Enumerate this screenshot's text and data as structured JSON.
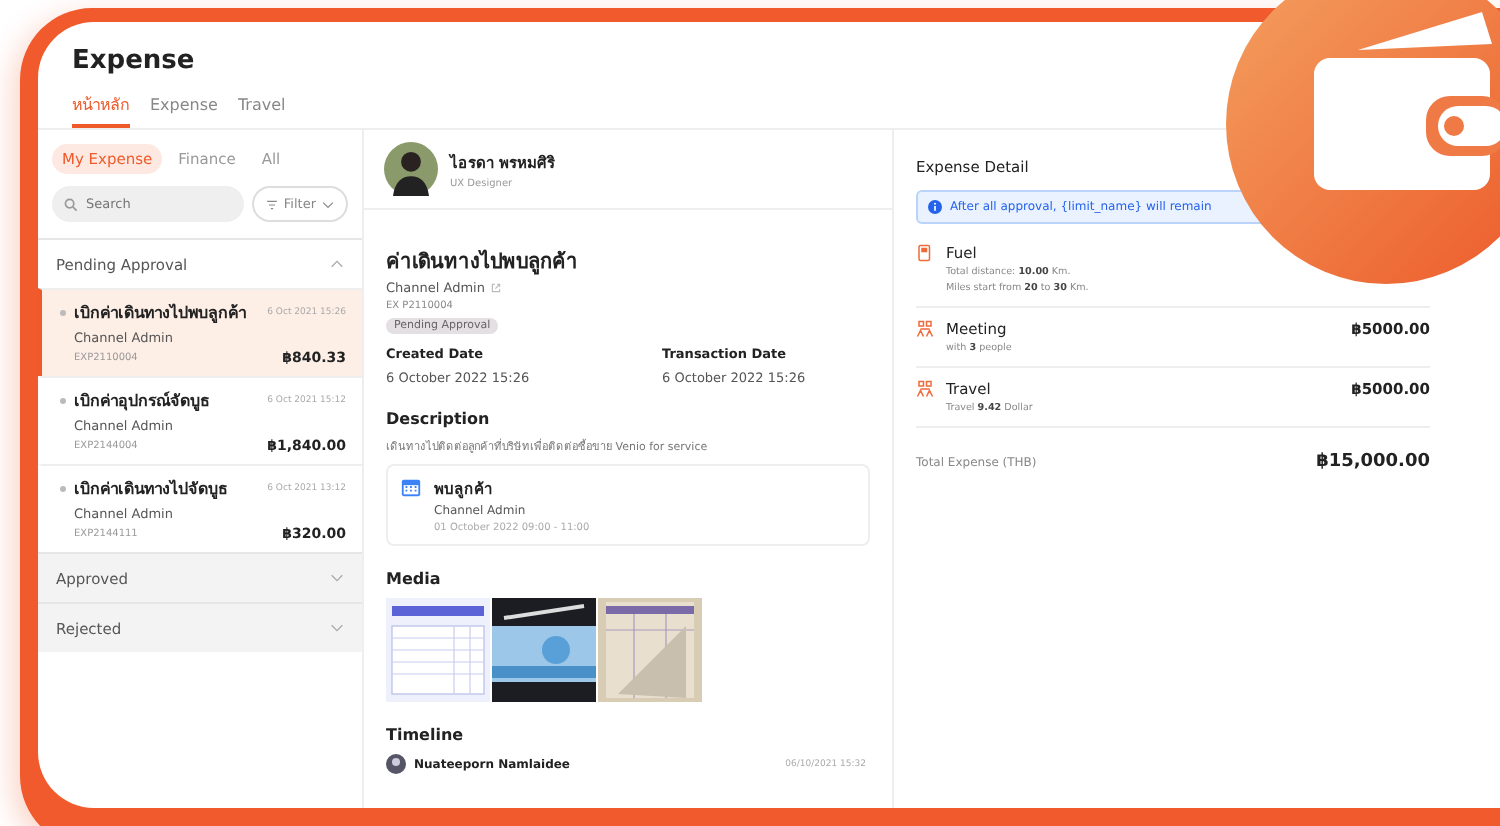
{
  "app": {
    "title": "Expense"
  },
  "tabs": [
    {
      "label": "หน้าหลัก",
      "selected": true
    },
    {
      "label": "Expense",
      "selected": false
    },
    {
      "label": "Travel",
      "selected": false
    }
  ],
  "filters": [
    {
      "label": "My Expense",
      "selected": true
    },
    {
      "label": "Finance",
      "selected": false
    },
    {
      "label": "All",
      "selected": false
    }
  ],
  "search": {
    "placeholder": "Search"
  },
  "filter_button": "Filter",
  "groups": [
    {
      "title": "Pending Approval",
      "expanded": true,
      "items": [
        {
          "title": "เบิกค่าเดินทางไปพบลูกค้า",
          "date": "6 Oct 2021 15:26",
          "owner": "Channel Admin",
          "code": "EXP2110004",
          "amount": "฿840.33",
          "selected": true
        },
        {
          "title": "เบิกค่าอุปกรณ์จัดบูธ",
          "date": "6 Oct 2021 15:12",
          "owner": "Channel Admin",
          "code": "EXP2144004",
          "amount": "฿1,840.00",
          "selected": false
        },
        {
          "title": "เบิกค่าเดินทางไปจัดบูธ",
          "date": "6 Oct 2021 13:12",
          "owner": "Channel Admin",
          "code": "EXP2144111",
          "amount": "฿320.00",
          "selected": false
        }
      ]
    },
    {
      "title": "Approved",
      "expanded": false
    },
    {
      "title": "Rejected",
      "expanded": false
    }
  ],
  "profile": {
    "name": "ไอรดา พรหมศิริ",
    "role": "UX Designer"
  },
  "detail": {
    "title": "ค่าเดินทางไปพบลูกค้า",
    "owner": "Channel Admin",
    "code": "EX P2110004",
    "status": "Pending Approval",
    "dates": [
      {
        "label": "Created Date",
        "value": "6 October 2022 15:26"
      },
      {
        "label": "Transaction Date",
        "value": "6 October 2022 15:26"
      }
    ],
    "description_heading": "Description",
    "description": "เดินทางไปติดต่อลูกค้าที่บริษัทเพื่อติดต่อซื้อขาย Venio for service",
    "event": {
      "title": "พบลูกค้า",
      "owner": "Channel Admin",
      "time": "01 October 2022 09:00 - 11:00"
    },
    "media_heading": "Media",
    "timeline_heading": "Timeline",
    "timeline": [
      {
        "name": "Nuateeporn Namlaidee",
        "time": "06/10/2021 15:32"
      }
    ]
  },
  "expense_detail": {
    "title": "Expense Detail",
    "notice": "After all approval, {limit_name} will remain",
    "items": [
      {
        "name": "Fuel",
        "lines": [
          "Total distance: **10.00** Km.",
          "Miles start from **20** to **30** Km."
        ]
      },
      {
        "name": "Meeting",
        "lines": [
          "with **3** people"
        ],
        "amount": "฿5000.00"
      },
      {
        "name": "Travel",
        "lines": [
          "Travel **9.42** Dollar"
        ],
        "amount": "฿5000.00"
      }
    ],
    "total_label": "Total Expense (THB)",
    "total": "฿15,000.00"
  }
}
